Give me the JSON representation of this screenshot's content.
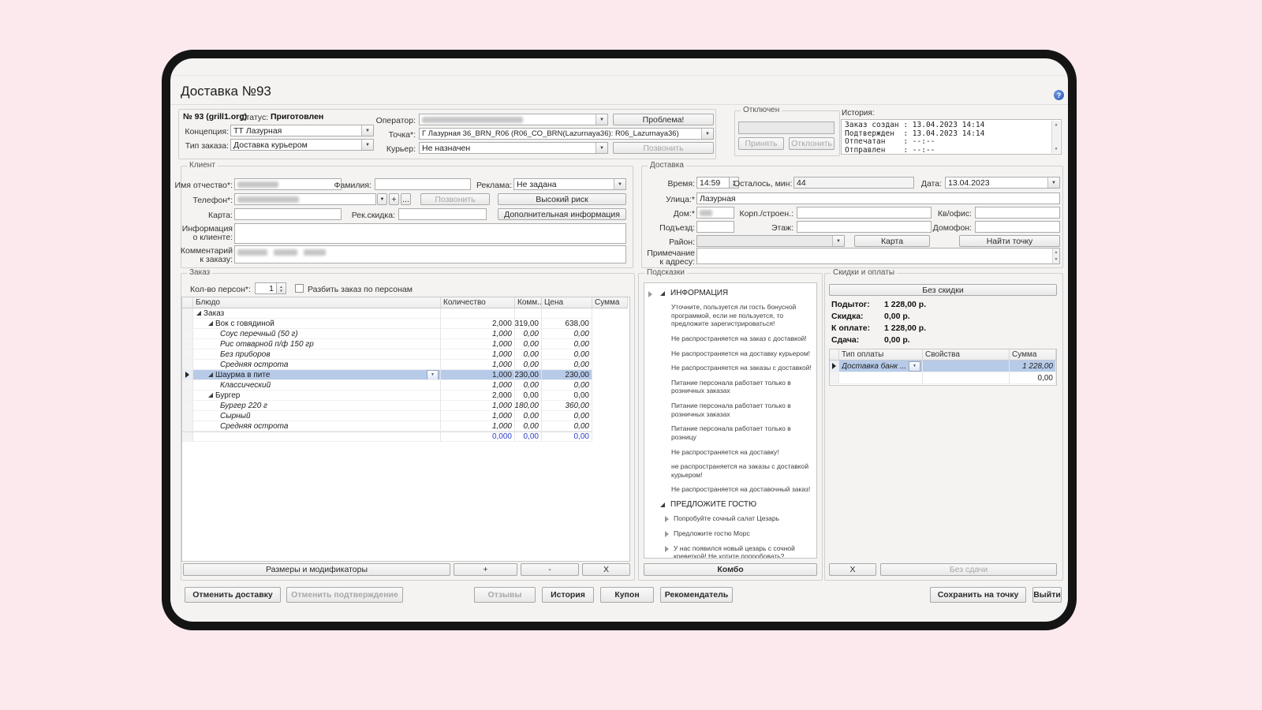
{
  "colors": {
    "page_background": "#fbe9ed",
    "window_frame": "#141414",
    "selection": "#b7cbe9",
    "totals_blue": "#2b3cc4"
  },
  "window": {
    "title": "Доставка №93"
  },
  "header": {
    "number": "№ 93 (grill1.org)",
    "status_label": "Статус:",
    "status_value": "Приготовлен",
    "concept_label": "Концепция:",
    "concept_value": "ТТ Лазурная",
    "order_type_label": "Тип заказа:",
    "order_type_value": "Доставка курьером",
    "operator_label": "Оператор:",
    "problem_button": "Проблема!",
    "point_label": "Точка*:",
    "point_value": "Г Лазурная 36_BRN_R06 (R06_CO_BRN(Lazurnaya36): R06_Lazurnaya36)",
    "courier_label": "Курьер:",
    "courier_value": "Не назначен",
    "call_button": "Позвонить",
    "disconnected": {
      "title": "Отключен",
      "accept_button": "Принять",
      "decline_button": "Отклонить"
    },
    "history": {
      "label": "История:",
      "lines": [
        "Заказ создан : 13.04.2023 14:14",
        "Подтвержден  : 13.04.2023 14:14",
        "Отпечатан    : --:--",
        "Отправлен    : --:--"
      ]
    }
  },
  "client": {
    "title": "Клиент",
    "name_label": "Имя отчество*:",
    "surname_label": "Фамилия:",
    "ad_label": "Реклама:",
    "ad_value": "Не задана",
    "phone_label": "Телефон*:",
    "phone_add_button": "+",
    "phone_more_button": "...",
    "call_button": "Позвонить",
    "high_risk_button": "Высокий риск",
    "card_label": "Карта:",
    "rec_discount_label": "Рек.скидка:",
    "additional_info_button": "Дополнительная информация",
    "info_label_1": "Информация",
    "info_label_2": "о клиенте:",
    "comment_label_1": "Комментарий",
    "comment_label_2": "к заказу:"
  },
  "delivery": {
    "title": "Доставка",
    "time_label": "Время:",
    "time_value": "14:59",
    "left_label": "Осталось, мин:",
    "left_value": "44",
    "date_label": "Дата:",
    "date_value": "13.04.2023",
    "street_label": "Улица:*",
    "street_value": "Лазурная",
    "house_label": "Дом:*",
    "building_label": "Корп./строен.:",
    "apt_label": "Кв/офис:",
    "entrance_label": "Подъезд:",
    "floor_label": "Этаж:",
    "intercom_label": "Домофон:",
    "district_label": "Район:",
    "map_button": "Карта",
    "find_point_button": "Найти точку",
    "note_label_1": "Примечание",
    "note_label_2": "к адресу:"
  },
  "order": {
    "title": "Заказ",
    "persons_label": "Кол-во персон*:",
    "persons_value": "1",
    "split_checkbox_label": "Разбить заказ по персонам",
    "columns": [
      "Блюдо",
      "Количество",
      "Комм...",
      "Цена",
      "Сумма"
    ],
    "rows": [
      {
        "name": "Заказ",
        "qty": "",
        "price": "",
        "sum": "",
        "level": 0,
        "style": "group",
        "expanded": true
      },
      {
        "name": "Вок с говядиной",
        "qty": "2,000",
        "price": "319,00",
        "sum": "638,00",
        "level": 1,
        "style": "dish",
        "expanded": true
      },
      {
        "name": "Соус перечный (50 г)",
        "qty": "1,000",
        "price": "0,00",
        "sum": "0,00",
        "level": 2,
        "style": "mod"
      },
      {
        "name": "Рис отварной п/ф 150 гр",
        "qty": "1,000",
        "price": "0,00",
        "sum": "0,00",
        "level": 2,
        "style": "mod"
      },
      {
        "name": "Без приборов",
        "qty": "1,000",
        "price": "0,00",
        "sum": "0,00",
        "level": 2,
        "style": "mod"
      },
      {
        "name": "Средняя острота",
        "qty": "1,000",
        "price": "0,00",
        "sum": "0,00",
        "level": 2,
        "style": "mod"
      },
      {
        "name": "Шаурма в пите",
        "qty": "1,000",
        "price": "230,00",
        "sum": "230,00",
        "level": 1,
        "style": "dish",
        "expanded": true,
        "selected": true
      },
      {
        "name": "Классический",
        "qty": "1,000",
        "price": "0,00",
        "sum": "0,00",
        "level": 2,
        "style": "mod"
      },
      {
        "name": "Бургер",
        "qty": "2,000",
        "price": "0,00",
        "sum": "0,00",
        "level": 1,
        "style": "dish",
        "expanded": true
      },
      {
        "name": "Бургер 220 г",
        "qty": "1,000",
        "price": "180,00",
        "sum": "360,00",
        "level": 2,
        "style": "mod"
      },
      {
        "name": "Сырный",
        "qty": "1,000",
        "price": "0,00",
        "sum": "0,00",
        "level": 2,
        "style": "mod"
      },
      {
        "name": "Средняя острота",
        "qty": "1,000",
        "price": "0,00",
        "sum": "0,00",
        "level": 2,
        "style": "mod"
      },
      {
        "name": "",
        "qty": "0,000",
        "price": "0,00",
        "sum": "0,00",
        "level": 0,
        "style": "total"
      }
    ],
    "sizes_button": "Размеры и модификаторы",
    "plus_button": "+",
    "minus_button": "-",
    "x_button": "X"
  },
  "hints": {
    "title": "Подсказки",
    "info_label": "ИНФОРМАЦИЯ",
    "info_items": [
      "Уточните, пользуется ли гость бонусной программой, если не пользуется, то предложите зарегистрироваться!",
      "Не распространяется на заказ с доставкой!",
      "Не распространяется на доставку курьером!",
      "Не распространяется на заказы с доставкой!",
      "Питание персонала работает только в розничных заказах",
      "Питание персонала работает только в розничных заказах",
      "Питание персонала работает только в розницу",
      "Не распространяется на доставку!",
      "не распространяется на заказы с доставкой курьером!",
      "Не распространяется на доставочный заказ!"
    ],
    "suggest_label": "ПРЕДЛОЖИТЕ ГОСТЮ",
    "suggest_items": [
      "Попробуйте сочный салат Цезарь",
      "Предложите гостю Морс",
      "У нас появился новый цезарь с сочной креветкой! Не хотите попробовать?"
    ],
    "combo_button": "Комбо"
  },
  "discounts": {
    "title": "Скидки и оплаты",
    "no_discount_button": "Без скидки",
    "subtotal_label": "Подытог:",
    "subtotal_value": "1 228,00 р.",
    "discount_label": "Скидка:",
    "discount_value": "0,00 р.",
    "to_pay_label": "К оплате:",
    "to_pay_value": "1 228,00 р.",
    "change_label": "Сдача:",
    "change_value": "0,00 р.",
    "payment_columns": [
      "Тип оплаты",
      "Свойства",
      "Сумма"
    ],
    "payments": [
      {
        "type": "Доставка банк ...",
        "props": "",
        "sum": "1 228,00",
        "selected": true
      },
      {
        "type": "",
        "props": "",
        "sum": "0,00",
        "selected": false
      }
    ],
    "x_button": "X",
    "no_change_button": "Без сдачи"
  },
  "bottom": {
    "cancel_delivery": "Отменить доставку",
    "cancel_confirm": "Отменить подтверждение",
    "reviews": "Отзывы",
    "history": "История",
    "coupon": "Купон",
    "recommender": "Рекомендатель",
    "save_to_point": "Сохранить на точку",
    "exit": "Выйти"
  }
}
